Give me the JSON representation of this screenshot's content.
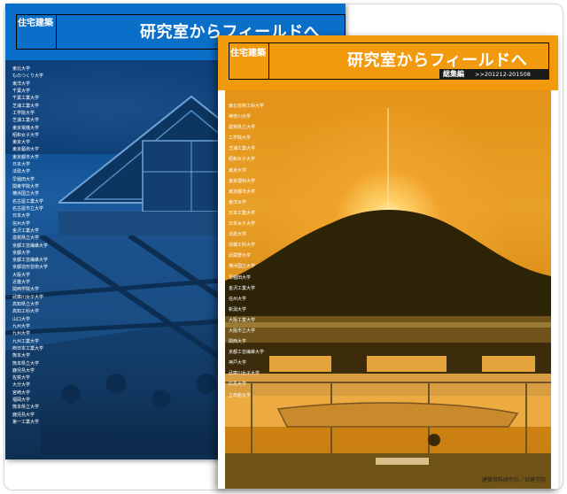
{
  "back_cover": {
    "series_tag": "住宅建築",
    "title": "研究室からフィールドへ",
    "university_list": [
      "東北大学",
      "ものつくり大学",
      "東洋大学",
      "千葉大学",
      "千葉工業大学",
      "芝浦工業大学",
      "工学院大学",
      "芝浦工業大学",
      "東京電機大学",
      "昭和女子大学",
      "東京大学",
      "東京藝術大学",
      "東京都市大学",
      "日本大学",
      "法政大学",
      "早稲田大学",
      "関東学院大学",
      "横浜国立大学",
      "名古屋工業大学",
      "名古屋市立大学",
      "日本大学",
      "信州大学",
      "金沢工業大学",
      "滋賀県立大学",
      "京都工芸繊維大学",
      "京都大学",
      "京都工芸繊維大学",
      "京都造形芸術大学",
      "大阪大学",
      "近畿大学",
      "関西学院大学",
      "武庫川女子大学",
      "高知県立大学",
      "高知工科大学",
      "山口大学",
      "九州大学",
      "九州大学",
      "九州工業大学",
      "西日本工業大学",
      "熊本大学",
      "熊本県立大学",
      "鹿児島大学",
      "佐賀大学",
      "大分大学",
      "宮崎大学",
      "福岡大学",
      "熊本県立大学",
      "鹿児島大学",
      "第一工業大学"
    ]
  },
  "front_cover": {
    "series_tag": "住宅建築",
    "title": "研究室からフィールドへ",
    "edition_label": "総集編",
    "date_range": ">>201212-201508",
    "university_list": [
      "東北芸術工科大学",
      "神奈川大学",
      "滋賀県立大学",
      "工学院大学",
      "芝浦工業大学",
      "昭和女子大学",
      "東京大学",
      "東京理科大学",
      "東京都市大学",
      "東洋大学",
      "日本工業大学",
      "日本女子大学",
      "法政大学",
      "前橋工科大学",
      "武蔵野大学",
      "横浜国立大学",
      "早稲田大学",
      "金沢工業大学",
      "信州大学",
      "新潟大学",
      "大阪工業大学",
      "大阪市立大学",
      "関西大学",
      "京都工芸繊維大学",
      "神戸大学",
      "武庫川女子大学",
      "広島大学",
      "立命館大学"
    ],
    "publisher": "建築資料研究社／日建学院"
  },
  "colors": {
    "blue_accent": "#0a6fc8",
    "orange_accent": "#f29a0e"
  }
}
